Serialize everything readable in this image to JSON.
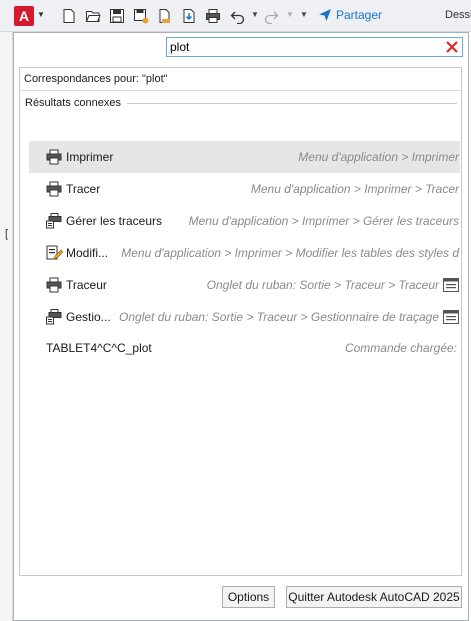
{
  "qat": {
    "app_letter": "A",
    "share_label": "Partager",
    "title_fragment": "Dessi",
    "icons": [
      "new-icon",
      "open-icon",
      "save-icon",
      "save-as-icon",
      "open-from-web-icon",
      "save-to-web-icon",
      "plot-icon",
      "undo-icon",
      "redo-icon",
      "customize-caret-icon",
      "share-icon"
    ]
  },
  "left_strip": {
    "glyph": "["
  },
  "search": {
    "value": "plot"
  },
  "results": {
    "matches_label": "Correspondances pour: \"plot\"",
    "group_label": "Résultats connexes",
    "items": [
      {
        "name": "Imprimer",
        "path": "Menu d'application > Imprimer",
        "icon": "printer-icon",
        "selected": true
      },
      {
        "name": "Tracer",
        "path": "Menu d'application > Imprimer > Tracer",
        "icon": "printer-icon",
        "selected": false
      },
      {
        "name": "Gérer les traceurs",
        "path": "Menu d'application > Imprimer > Gérer les traceurs",
        "icon": "plotter-manager-icon",
        "selected": false
      },
      {
        "name": "Modifi...",
        "path": "Menu d'application > Imprimer > Modifier les tables des styles d",
        "icon": "edit-plot-style-icon",
        "selected": false
      },
      {
        "name": "Traceur",
        "path": "Onglet du ruban: Sortie > Traceur > Traceur",
        "icon": "printer-icon",
        "selected": false,
        "tail_icon": "ribbon-panel-icon"
      },
      {
        "name": "Gestio...",
        "path": "Onglet du ruban: Sortie > Traceur > Gestionnaire de traçage",
        "icon": "plotter-manager-icon",
        "selected": false,
        "tail_icon": "ribbon-panel-icon"
      },
      {
        "name": "TABLET4^C^C_plot",
        "path": "Commande chargée:",
        "icon": "",
        "selected": false
      }
    ]
  },
  "buttons": {
    "options": "Options",
    "quit": "Quitter Autodesk AutoCAD 2025"
  },
  "colors": {
    "accent": "#d5192e",
    "share_blue": "#1a73c8",
    "selected_row": "#e6e6e6",
    "clear_x": "#e0282a"
  }
}
